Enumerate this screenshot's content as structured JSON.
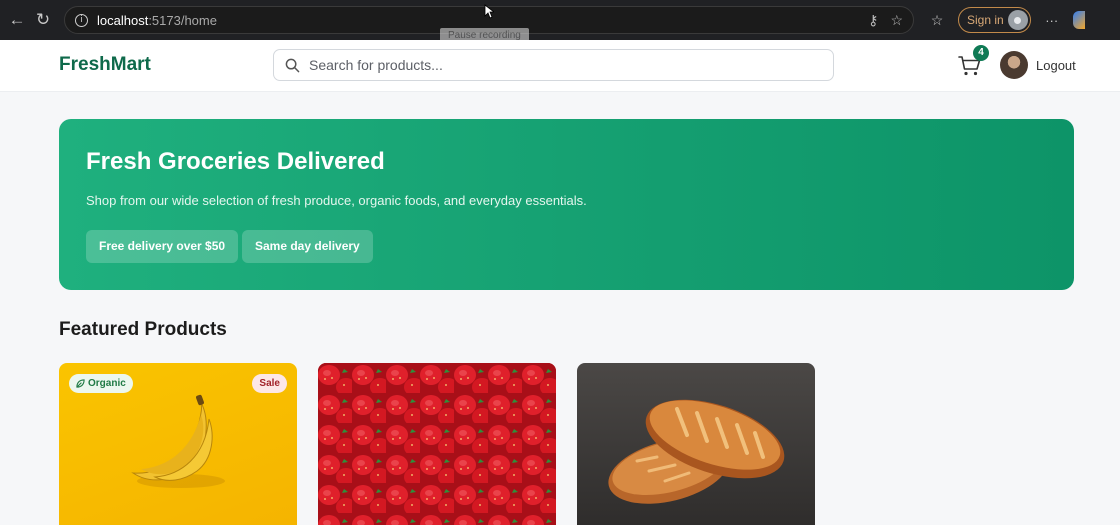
{
  "browser": {
    "url_host": "localhost",
    "url_path": ":5173/home",
    "sign_in_label": "Sign in",
    "tooltip": "Pause recording"
  },
  "header": {
    "brand": "FreshMart",
    "search_placeholder": "Search for products...",
    "cart_count": "4",
    "logout_label": "Logout"
  },
  "hero": {
    "title": "Fresh Groceries Delivered",
    "subtitle": "Shop from our wide selection of fresh produce, organic foods, and everyday essentials.",
    "chips": [
      "Free delivery over $50",
      "Same day delivery"
    ]
  },
  "featured": {
    "title": "Featured Products",
    "products": [
      {
        "image": "banana-image",
        "badges": [
          "Organic",
          "Sale"
        ]
      },
      {
        "image": "strawberries-image",
        "badges": []
      },
      {
        "image": "bread-image",
        "badges": []
      }
    ]
  },
  "colors": {
    "brand": "#0f6a4b",
    "hero": "#149e70",
    "chrome": "#202124"
  }
}
